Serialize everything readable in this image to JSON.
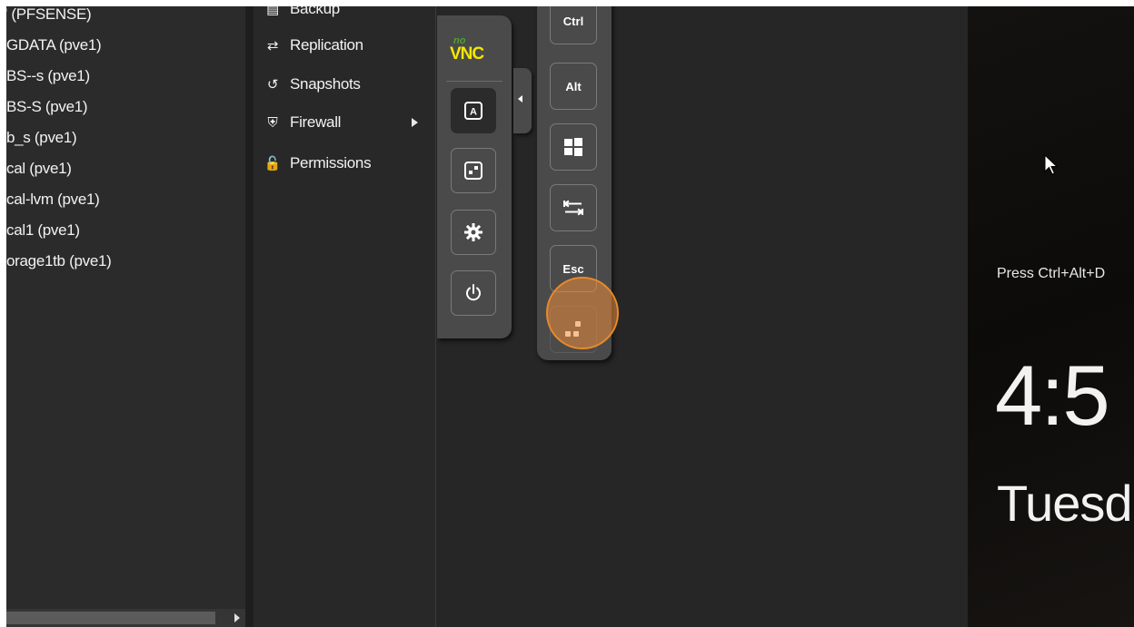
{
  "tree": {
    "items": [
      {
        "label": "' (PFSENSE)"
      },
      {
        "label": "GDATA (pve1)"
      },
      {
        "label": "BS--s (pve1)"
      },
      {
        "label": "BS-S (pve1)"
      },
      {
        "label": "b_s (pve1)"
      },
      {
        "label": "cal (pve1)"
      },
      {
        "label": "cal-lvm (pve1)"
      },
      {
        "label": "cal1 (pve1)"
      },
      {
        "label": "orage1tb (pve1)"
      }
    ]
  },
  "vm_menu": {
    "items": [
      {
        "label": "Backup",
        "icon": "save-icon"
      },
      {
        "label": "Replication",
        "icon": "replication-icon"
      },
      {
        "label": "Snapshots",
        "icon": "history-icon"
      },
      {
        "label": "Firewall",
        "icon": "shield-icon"
      },
      {
        "label": "Permissions",
        "icon": "unlock-icon"
      }
    ]
  },
  "novnc": {
    "logo_small": "no",
    "logo_large": "VNC",
    "buttons": [
      {
        "icon": "keyboard-a-icon"
      },
      {
        "icon": "clipboard-icon"
      },
      {
        "icon": "settings-gear-icon"
      },
      {
        "icon": "power-icon"
      }
    ]
  },
  "extra_keys": {
    "ctrl": "Ctrl",
    "alt": "Alt",
    "windows": "windows-icon",
    "tab": "tab-icon",
    "esc": "Esc",
    "cad": "ctrl-alt-del-icon"
  },
  "lockscreen": {
    "prompt": "Press Ctrl+Alt+D",
    "time": "4:5",
    "day": "Tuesd"
  },
  "colors": {
    "background": "#2a2a2a",
    "toolbar": "#4a4a4a",
    "logo_green": "#4fa330",
    "logo_yellow": "#f3e800",
    "highlight": "#e88a2a"
  }
}
